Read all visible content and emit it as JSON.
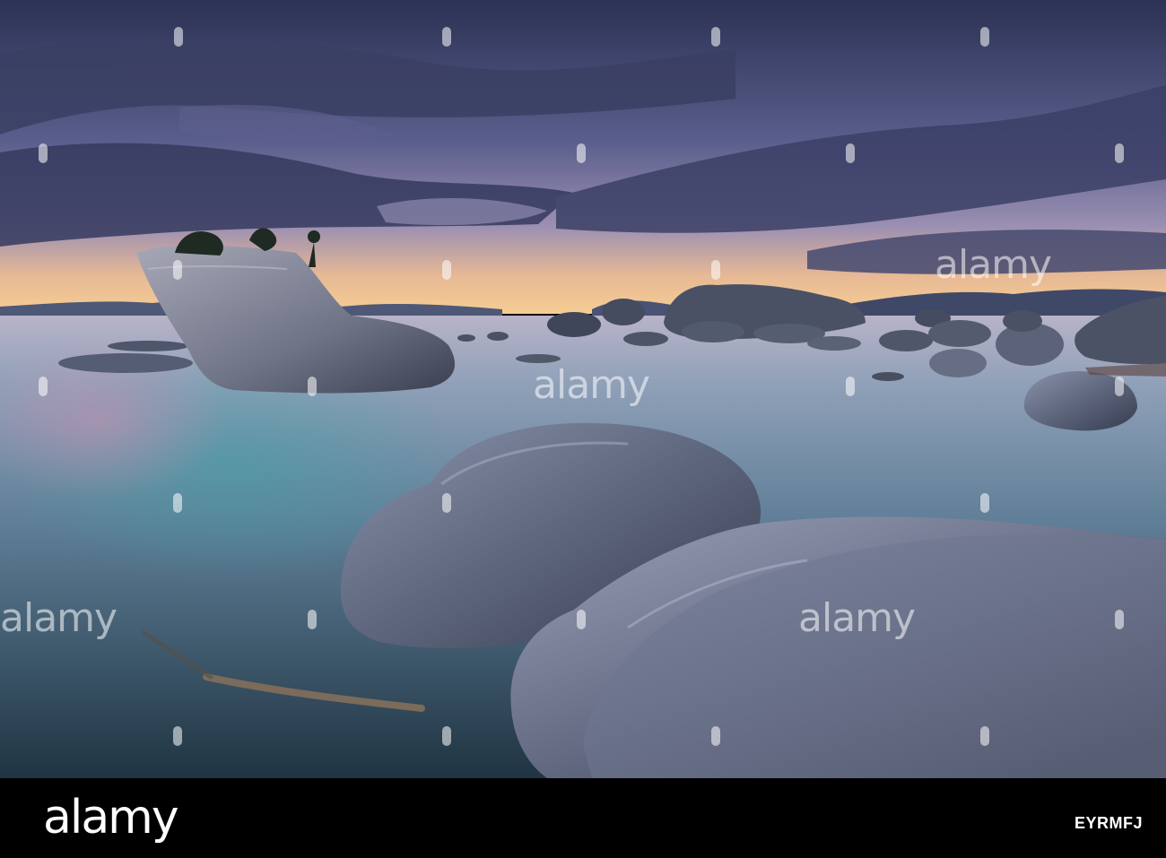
{
  "photo": {
    "description_icon": "landscape-photo",
    "colors": {
      "sky_top": "#2c3356",
      "sky_mid": "#5b5f8e",
      "horizon_glow": "#f3c48e",
      "water": "#6d8aa6",
      "water_deep": "#23394a",
      "rock": "#5d6478",
      "rock_dark": "#2e3343"
    }
  },
  "watermark": {
    "word": "alamy",
    "footer_logo": "alamy",
    "image_id": "EYRMFJ"
  }
}
